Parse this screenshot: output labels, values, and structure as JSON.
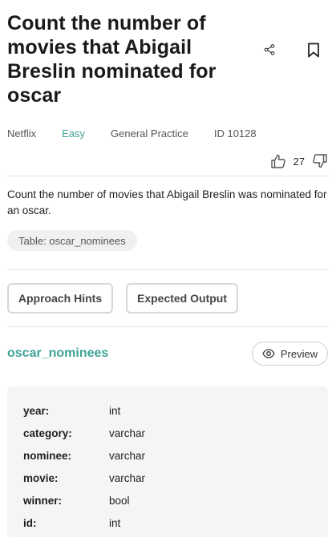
{
  "question": {
    "title": "Count the number of movies that Abigail Breslin nominated for oscar",
    "company": "Netflix",
    "difficulty": "Easy",
    "category": "General Practice",
    "id_label": "ID 10128",
    "votes_up": "27",
    "description": "Count the number of movies that Abigail Breslin was nominated for an oscar.",
    "table_chip": "Table: oscar_nominees"
  },
  "actions": {
    "hints_label": "Approach Hints",
    "output_label": "Expected Output"
  },
  "table": {
    "name": "oscar_nominees",
    "preview_label": "Preview",
    "columns": [
      {
        "name": "year:",
        "type": "int"
      },
      {
        "name": "category:",
        "type": "varchar"
      },
      {
        "name": "nominee:",
        "type": "varchar"
      },
      {
        "name": "movie:",
        "type": "varchar"
      },
      {
        "name": "winner:",
        "type": "bool"
      },
      {
        "name": "id:",
        "type": "int"
      }
    ]
  },
  "colors": {
    "accent": "#3fa396",
    "chip_bg": "#eef1ee",
    "schema_bg": "#f4f5f7"
  },
  "icons": [
    "share-icon",
    "bookmark-icon",
    "thumbs-up-icon",
    "thumbs-down-icon",
    "eye-icon"
  ]
}
